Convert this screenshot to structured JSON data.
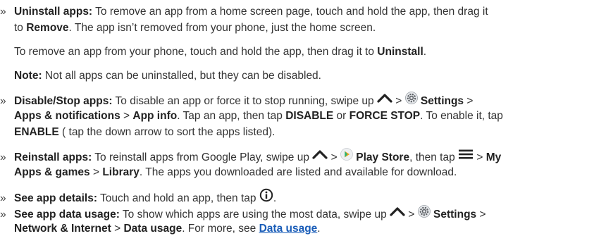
{
  "bullet_char": "»",
  "uninstall": {
    "label": "Uninstall apps:",
    "t1": " To remove an app from a home screen page, touch and hold the app, then drag it",
    "t2a": "to ",
    "remove": "Remove",
    "t2b": ". The app isn’t removed from your phone, just the home screen.",
    "p2a": "To remove an app from your phone, touch and hold the app, then drag it to ",
    "uninstall_word": "Uninstall",
    "p2b": ".",
    "note_label": "Note:",
    "note_text": " Not all apps can be uninstalled, but they can be disabled."
  },
  "disable": {
    "label": "Disable/Stop apps:",
    "t1": " To disable an app or force it to stop running, swipe up ",
    "gt1": " > ",
    "settings": "Settings",
    "gt2": " >",
    "apps_notif": "Apps & notifications",
    "gt3": " > ",
    "app_info": "App info",
    "t2": ". Tap an app, then tap ",
    "disable_word": "DISABLE",
    "or": " or ",
    "force_stop": "FORCE STOP",
    "t3": ". To enable it, tap",
    "enable_word": "ENABLE",
    "t4": " ( tap the down arrow to sort the apps listed)."
  },
  "reinstall": {
    "label": "Reinstall apps:",
    "t1": " To reinstall apps from Google Play, swipe up ",
    "gt1": " > ",
    "play_store": "Play Store",
    "t2": ", then tap ",
    "gt2": " > ",
    "my": "My",
    "apps_games": "Apps & games",
    "gt3": " > ",
    "library": "Library",
    "t3": ". The apps you downloaded are listed and available for download."
  },
  "details": {
    "label": "See app details:",
    "t1": " Touch and hold an app, then tap ",
    "t2": "."
  },
  "usage": {
    "label": "See app data usage:",
    "t1": " To show which apps are using the most data, swipe up ",
    "gt1": " > ",
    "settings": "Settings",
    "gt2": " >",
    "net": "Network & Internet",
    "gt3": " > ",
    "data_usage": "Data usage",
    "t2": ". For more, see ",
    "link": "Data usage",
    "t3": "."
  },
  "icons": {
    "up": "chevron-up-icon",
    "settings": "settings-gear-icon",
    "play": "play-store-icon",
    "menu": "menu-icon",
    "info": "info-icon"
  },
  "colors": {
    "text": "#333333",
    "link": "#1a5db8",
    "play": "#f4a11a"
  }
}
